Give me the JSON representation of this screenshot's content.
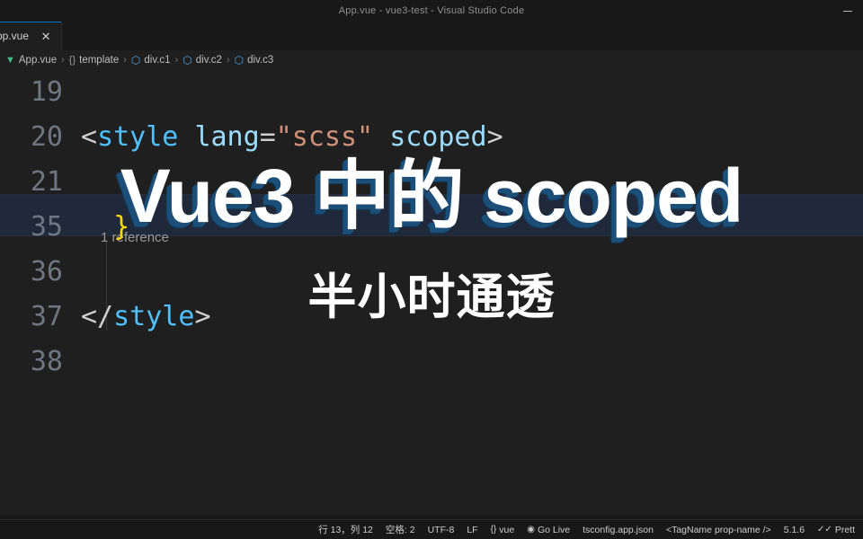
{
  "window": {
    "title": "App.vue - vue3-test - Visual Studio Code",
    "minimize_label": "—"
  },
  "tabs": [
    {
      "label": "pp.vue",
      "close_label": "✕",
      "active": true
    }
  ],
  "breadcrumb": {
    "separator": "›",
    "items": [
      {
        "icon": "vue-file-icon",
        "glyph": "▼",
        "label": "App.vue"
      },
      {
        "icon": "braces-icon",
        "glyph": "{}",
        "label": "template"
      },
      {
        "icon": "cube-icon",
        "glyph": "⬡",
        "label": "div.c1"
      },
      {
        "icon": "cube-icon",
        "glyph": "⬡",
        "label": "div.c2"
      },
      {
        "icon": "cube-icon",
        "glyph": "⬡",
        "label": "div.c3"
      }
    ]
  },
  "editor": {
    "codelens": "1 reference",
    "lines": [
      {
        "number": "19",
        "text": ""
      },
      {
        "number": "20",
        "text": "<style lang=\"scss\" scoped>"
      },
      {
        "number": "21",
        "text": ""
      },
      {
        "number": "35",
        "text": "  }"
      },
      {
        "number": "36",
        "text": ""
      },
      {
        "number": "37",
        "text": "</style>"
      },
      {
        "number": "38",
        "text": ""
      }
    ],
    "tokens_line20": {
      "open_angle": "<",
      "tag": "style",
      "attr_lang": "lang",
      "equals": "=",
      "value_scss": "\"scss\"",
      "attr_scoped": "scoped",
      "close_angle": ">"
    },
    "tokens_line35": {
      "brace": "}"
    },
    "tokens_line37": {
      "open": "</",
      "tag": "style",
      "close": ">"
    }
  },
  "statusbar": {
    "items": [
      {
        "name": "cursor-position",
        "icon": "",
        "label": "行 13，列 12"
      },
      {
        "name": "indentation",
        "icon": "",
        "label": "空格: 2"
      },
      {
        "name": "encoding",
        "icon": "",
        "label": "UTF-8"
      },
      {
        "name": "line-endings",
        "icon": "",
        "label": "LF"
      },
      {
        "name": "language-mode",
        "icon": "{}",
        "label": "vue"
      },
      {
        "name": "go-live",
        "icon": "◉",
        "label": "Go Live"
      },
      {
        "name": "tsconfig",
        "icon": "",
        "label": "tsconfig.app.json"
      },
      {
        "name": "tag-props",
        "icon": "",
        "label": "<TagName prop-name />"
      },
      {
        "name": "version",
        "icon": "",
        "label": "5.1.6"
      },
      {
        "name": "prettier",
        "icon": "✓✓",
        "label": "Prett"
      }
    ]
  },
  "overlay": {
    "title": "Vue3 中的 scoped",
    "subtitle": "半小时通透"
  },
  "colors": {
    "accent": "#0078d4",
    "editor_bg": "#1f1f1f",
    "chrome_bg": "#181818",
    "title_shadow": "#1d4e78",
    "vue_green": "#41b883",
    "tag_blue": "#4fc1ff",
    "string_orange": "#ce9178",
    "brace_yellow": "#ffd700"
  }
}
